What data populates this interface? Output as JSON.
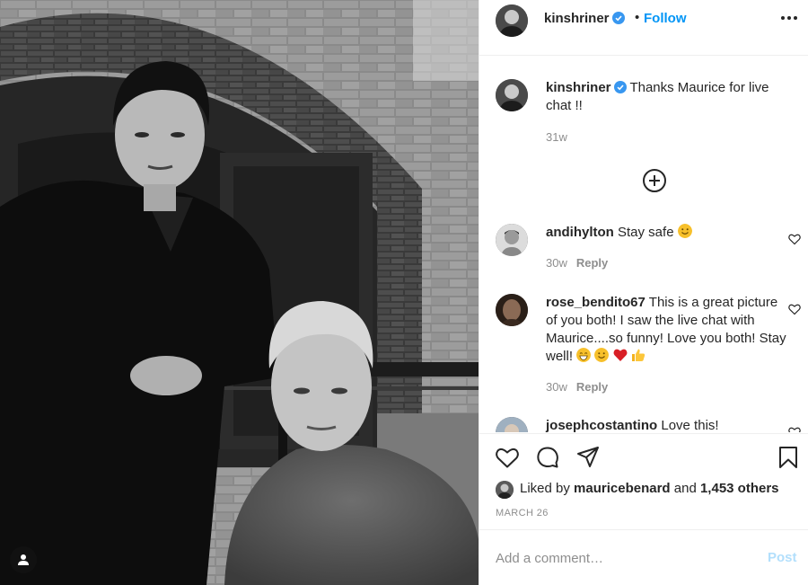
{
  "header": {
    "username": "kinshriner",
    "separator": "•",
    "follow_label": "Follow"
  },
  "caption": {
    "username": "kinshriner",
    "text": "Thanks Maurice for live chat !!",
    "time": "31w"
  },
  "comments": [
    {
      "username": "andihylton",
      "text": "Stay safe",
      "emojis": [
        "smiling-face"
      ],
      "time": "30w",
      "reply_label": "Reply"
    },
    {
      "username": "rose_bendito67",
      "text": "This is a great picture of you both! I saw the live chat with Maurice....so funny! Love you both! Stay well!",
      "emojis": [
        "grinning-face",
        "smiling-face",
        "red-heart",
        "thumbs-up"
      ],
      "time": "30w",
      "reply_label": "Reply"
    },
    {
      "username": "josephcostantino",
      "text": "Love this!",
      "emojis": [],
      "time": "",
      "reply_label": ""
    }
  ],
  "likes": {
    "prefix": "Liked by",
    "liker": "mauricebenard",
    "conjunction": "and",
    "others": "1,453 others"
  },
  "date": "MARCH 26",
  "add_comment": {
    "placeholder": "Add a comment…",
    "post_label": "Post"
  },
  "colors": {
    "accent": "#0095f6",
    "post_disabled": "#b2dffc",
    "text": "#262626",
    "muted": "#8e8e8e",
    "divider": "#efefef",
    "verified": "#3897f0"
  },
  "icons": [
    "verified-badge-icon",
    "more-options-icon",
    "load-more-icon",
    "heart-icon",
    "comment-icon",
    "share-icon",
    "bookmark-icon",
    "user-tag-icon"
  ]
}
